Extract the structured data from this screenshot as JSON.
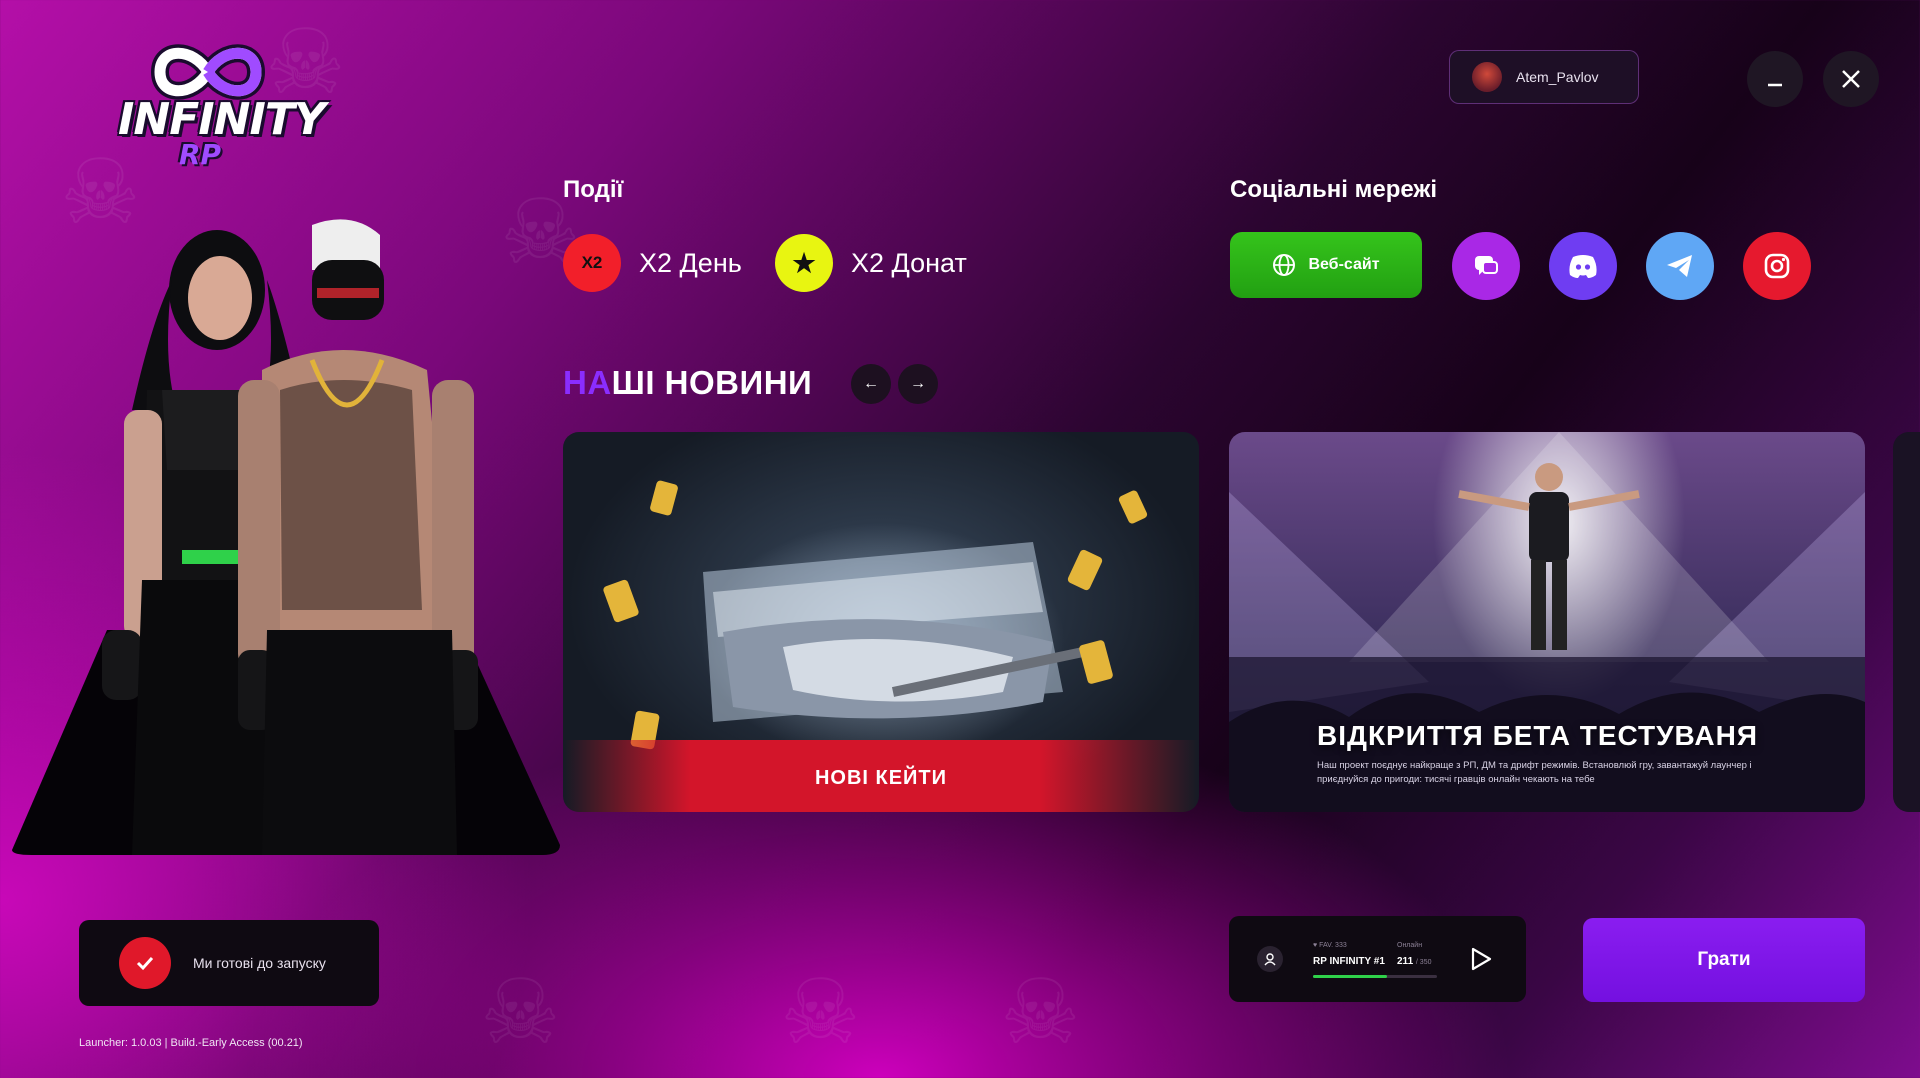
{
  "app": {
    "logo_word": "INFINITY",
    "logo_sub": "RP"
  },
  "user": {
    "name": "Atem_Pavlov"
  },
  "events": {
    "title": "Події",
    "items": [
      {
        "badge": "X2",
        "label": "X2 День",
        "color": "#f21f2a"
      },
      {
        "badge": "★",
        "label": "X2 Донат",
        "color": "#e8f511"
      }
    ]
  },
  "socials": {
    "title": "Соціальні мережі",
    "website_label": "Веб-сайт",
    "items": [
      {
        "name": "forum",
        "color": "#a928e6"
      },
      {
        "name": "discord",
        "color": "#6f3df2"
      },
      {
        "name": "telegram",
        "color": "#5fa7f5"
      },
      {
        "name": "instagram",
        "color": "#e6192e"
      }
    ]
  },
  "news": {
    "title_accent": "НА",
    "title_rest": "ШІ НОВИНИ",
    "prev": "←",
    "next": "→",
    "cards": [
      {
        "label": "НОВІ КЕЙТИ"
      },
      {
        "title": "ВІДКРИТТЯ БЕТА ТЕСТУВАНЯ",
        "description": "Наш проект поєднує найкраще з РП, ДМ та дрифт режимів. Встановлюй гру, завантажуй лаунчер і приєднуйся до пригоди: тисячі гравців онлайн чекають на тебе"
      }
    ]
  },
  "status": {
    "ready_text": "Ми готові до запуску"
  },
  "version": "Launcher: 1.0.03 | Build.-Early Access (00.21)",
  "server": {
    "favorites_label": "♥ FAV. 333",
    "name": "RP INFINITY #1",
    "online_label": "Онлайн",
    "online": "211",
    "max": "/ 350",
    "fill": 0.6
  },
  "play_label": "Грати",
  "colors": {
    "accent": "#7a14e6",
    "web_green": "#2cb416",
    "ready_red": "#e0182a"
  }
}
